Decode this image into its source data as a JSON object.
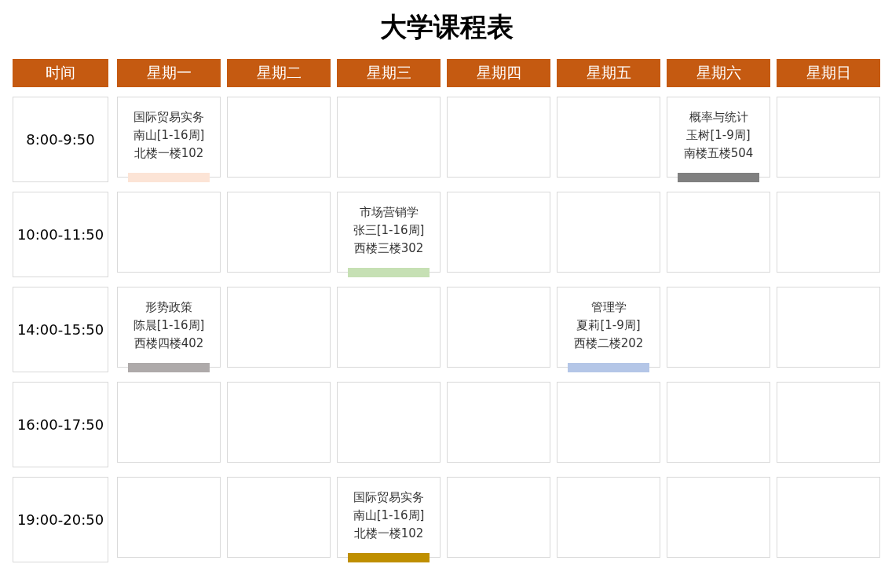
{
  "title": "大学课程表",
  "columns": [
    "时间",
    "星期一",
    "星期二",
    "星期三",
    "星期四",
    "星期五",
    "星期六",
    "星期日"
  ],
  "rows": [
    {
      "time": "8:00-9:50",
      "cells": [
        {
          "kind": "course",
          "name": "国际贸易实务",
          "teacher": "南山[1-16周]",
          "room": "北楼一楼102",
          "color": "#fce4d6"
        },
        {
          "kind": "empty"
        },
        {
          "kind": "empty"
        },
        {
          "kind": "empty"
        },
        {
          "kind": "empty"
        },
        {
          "kind": "course",
          "name": "概率与统计",
          "teacher": "玉树[1-9周]",
          "room": "南楼五楼504",
          "color": "#808080"
        },
        {
          "kind": "empty"
        }
      ]
    },
    {
      "time": "10:00-11:50",
      "cells": [
        {
          "kind": "empty"
        },
        {
          "kind": "empty"
        },
        {
          "kind": "course",
          "name": "市场营销学",
          "teacher": "张三[1-16周]",
          "room": "西楼三楼302",
          "color": "#c6e0b4"
        },
        {
          "kind": "empty"
        },
        {
          "kind": "empty"
        },
        {
          "kind": "empty"
        },
        {
          "kind": "empty"
        }
      ]
    },
    {
      "time": "14:00-15:50",
      "cells": [
        {
          "kind": "course",
          "name": "形势政策",
          "teacher": "陈晨[1-16周]",
          "room": "西楼四楼402",
          "color": "#aeaaaa"
        },
        {
          "kind": "empty"
        },
        {
          "kind": "empty"
        },
        {
          "kind": "empty"
        },
        {
          "kind": "course",
          "name": "管理学",
          "teacher": "夏莉[1-9周]",
          "room": "西楼二楼202",
          "color": "#b4c6e7"
        },
        {
          "kind": "empty"
        },
        {
          "kind": "empty"
        }
      ]
    },
    {
      "time": "16:00-17:50",
      "cells": [
        {
          "kind": "empty"
        },
        {
          "kind": "empty"
        },
        {
          "kind": "empty"
        },
        {
          "kind": "empty"
        },
        {
          "kind": "empty"
        },
        {
          "kind": "empty"
        },
        {
          "kind": "empty"
        }
      ]
    },
    {
      "time": "19:00-20:50",
      "cells": [
        {
          "kind": "empty"
        },
        {
          "kind": "empty"
        },
        {
          "kind": "course",
          "name": "国际贸易实务",
          "teacher": "南山[1-16周]",
          "room": "北楼一楼102",
          "color": "#bf8f00"
        },
        {
          "kind": "empty"
        },
        {
          "kind": "empty"
        },
        {
          "kind": "empty"
        },
        {
          "kind": "empty"
        }
      ]
    }
  ]
}
